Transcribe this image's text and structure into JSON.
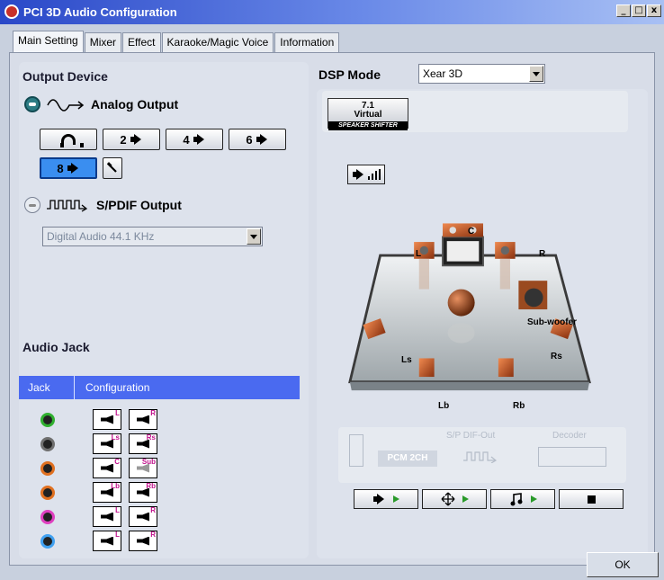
{
  "window": {
    "title": "PCI 3D Audio Configuration",
    "min_label": "_",
    "max_label": "□",
    "close_label": "x"
  },
  "tabs": [
    {
      "label": "Main Setting"
    },
    {
      "label": "Mixer"
    },
    {
      "label": "Effect"
    },
    {
      "label": "Karaoke/Magic Voice"
    },
    {
      "label": "Information"
    }
  ],
  "output": {
    "title": "Output Device",
    "analog_label": "Analog Output",
    "spdif_label": "S/PDIF Output",
    "speaker_buttons": [
      {
        "label": "2"
      },
      {
        "label": "4"
      },
      {
        "label": "6"
      },
      {
        "label": "8"
      }
    ],
    "spdif_select_value": "Digital Audio 44.1 KHz"
  },
  "audio_jack": {
    "title": "Audio Jack",
    "col_jack": "Jack",
    "col_config": "Configuration",
    "jacks": [
      {
        "color": "#30b030",
        "left": "L",
        "right": "R"
      },
      {
        "color": "#707070",
        "left": "Ls",
        "right": "Rs"
      },
      {
        "color": "#e07020",
        "left": "C",
        "right": "Sub"
      },
      {
        "color": "#e07020",
        "left": "Lb",
        "right": "Rb"
      },
      {
        "color": "#e040c0",
        "left": "L",
        "right": "R"
      },
      {
        "color": "#40a0f0",
        "left": "L",
        "right": "R"
      }
    ]
  },
  "dsp": {
    "title": "DSP Mode",
    "mode_value": "Xear 3D",
    "virtual_top": "7.1",
    "virtual_mid": "Virtual",
    "virtual_sub": "SPEAKER SHIFTER"
  },
  "speakers": {
    "c": "C",
    "l": "L",
    "r": "R",
    "sub": "Sub-woofer",
    "ls": "Ls",
    "rs": "Rs",
    "lb": "Lb",
    "rb": "Rb"
  },
  "decoder": {
    "pcm": "PCM 2CH",
    "spdif_out": "S/P DIF-Out",
    "decoder": "Decoder"
  },
  "footer": {
    "ok_label": "OK"
  }
}
